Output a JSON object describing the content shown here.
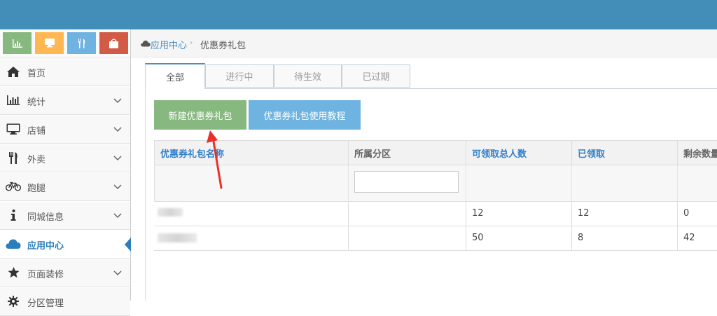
{
  "colors": {
    "topbar": "#438eb9",
    "accent": "#2b7dbc",
    "btn_green": "#87b87f",
    "btn_blue": "#6fb3e0",
    "arrow": "#e8312a"
  },
  "shortcuts": [
    {
      "icon": "bar-chart-icon",
      "color": "#87b87f"
    },
    {
      "icon": "desktop-icon",
      "color": "#ffb752"
    },
    {
      "icon": "cutlery-icon",
      "color": "#6fb3e0"
    },
    {
      "icon": "shopping-bag-icon",
      "color": "#d15b47"
    }
  ],
  "sidebar": {
    "items": [
      {
        "label": "首页",
        "icon": "home-icon"
      },
      {
        "label": "统计",
        "icon": "bar-chart-icon"
      },
      {
        "label": "店铺",
        "icon": "desktop-icon"
      },
      {
        "label": "外卖",
        "icon": "cutlery-icon"
      },
      {
        "label": "跑腿",
        "icon": "bicycle-icon"
      },
      {
        "label": "同城信息",
        "icon": "info-icon"
      },
      {
        "label": "应用中心",
        "icon": "cloud-icon",
        "active": true
      },
      {
        "label": "页面装修",
        "icon": "star-icon"
      },
      {
        "label": "分区管理",
        "icon": "gear-icon"
      }
    ]
  },
  "breadcrumb": {
    "parent": "应用中心",
    "separator": "›",
    "current": "优惠券礼包"
  },
  "tabs": [
    "全部",
    "进行中",
    "待生效",
    "已过期"
  ],
  "buttons": {
    "new": "新建优惠券礼包",
    "tutorial": "优惠券礼包使用教程"
  },
  "table": {
    "headers": [
      "优惠券礼包名称",
      "所属分区",
      "可领取总人数",
      "已领取",
      "剩余数量"
    ],
    "rows": [
      {
        "total": "12",
        "received": "12",
        "remaining": "0"
      },
      {
        "total": "50",
        "received": "8",
        "remaining": "42"
      }
    ]
  }
}
